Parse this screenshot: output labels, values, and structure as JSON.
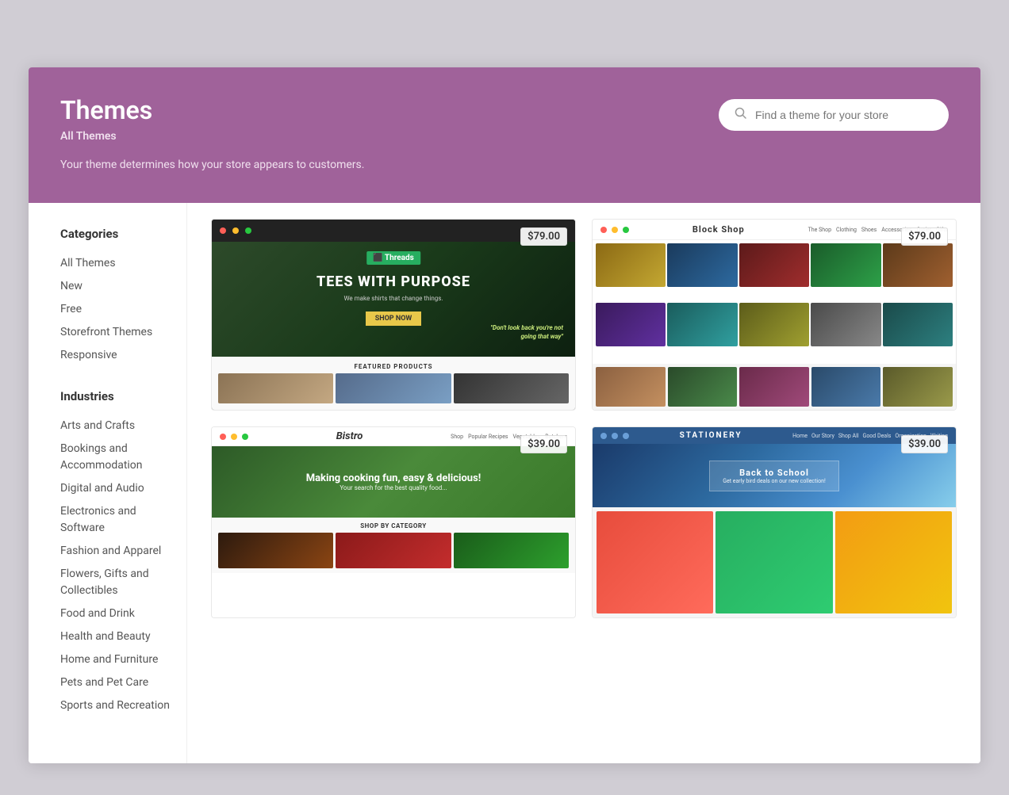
{
  "page": {
    "title": "Themes",
    "subtitle": "All Themes",
    "description": "Your theme determines how your store appears to customers.",
    "search_placeholder": "Find a theme for your store"
  },
  "sidebar": {
    "categories_title": "Categories",
    "categories": [
      {
        "label": "All Themes",
        "active": true
      },
      {
        "label": "New"
      },
      {
        "label": "Free"
      },
      {
        "label": "Storefront Themes"
      },
      {
        "label": "Responsive"
      }
    ],
    "industries_title": "Industries",
    "industries": [
      {
        "label": "Arts and Crafts"
      },
      {
        "label": "Bookings and Accommodation"
      },
      {
        "label": "Digital and Audio"
      },
      {
        "label": "Electronics and Software"
      },
      {
        "label": "Fashion and Apparel"
      },
      {
        "label": "Flowers, Gifts and Collectibles"
      },
      {
        "label": "Food and Drink"
      },
      {
        "label": "Health and Beauty"
      },
      {
        "label": "Home and Furniture"
      },
      {
        "label": "Pets and Pet Care"
      },
      {
        "label": "Sports and Recreation"
      }
    ]
  },
  "themes": [
    {
      "id": "threads",
      "name": "Threads",
      "price": "$79.00",
      "headline": "TEES WITH PURPOSE",
      "description": "We make shirts that change things."
    },
    {
      "id": "blockshop",
      "name": "Block Shop",
      "price": "$79.00"
    },
    {
      "id": "bistro",
      "name": "Bistro",
      "price": "$39.00",
      "headline": "Making cooking fun, easy & delicious!",
      "categories_title": "Shop by Category"
    },
    {
      "id": "stationery",
      "name": "Stationery",
      "price": "$39.00",
      "headline": "Back to School",
      "subheadline": "Get early bird deals on our new collection!"
    }
  ]
}
